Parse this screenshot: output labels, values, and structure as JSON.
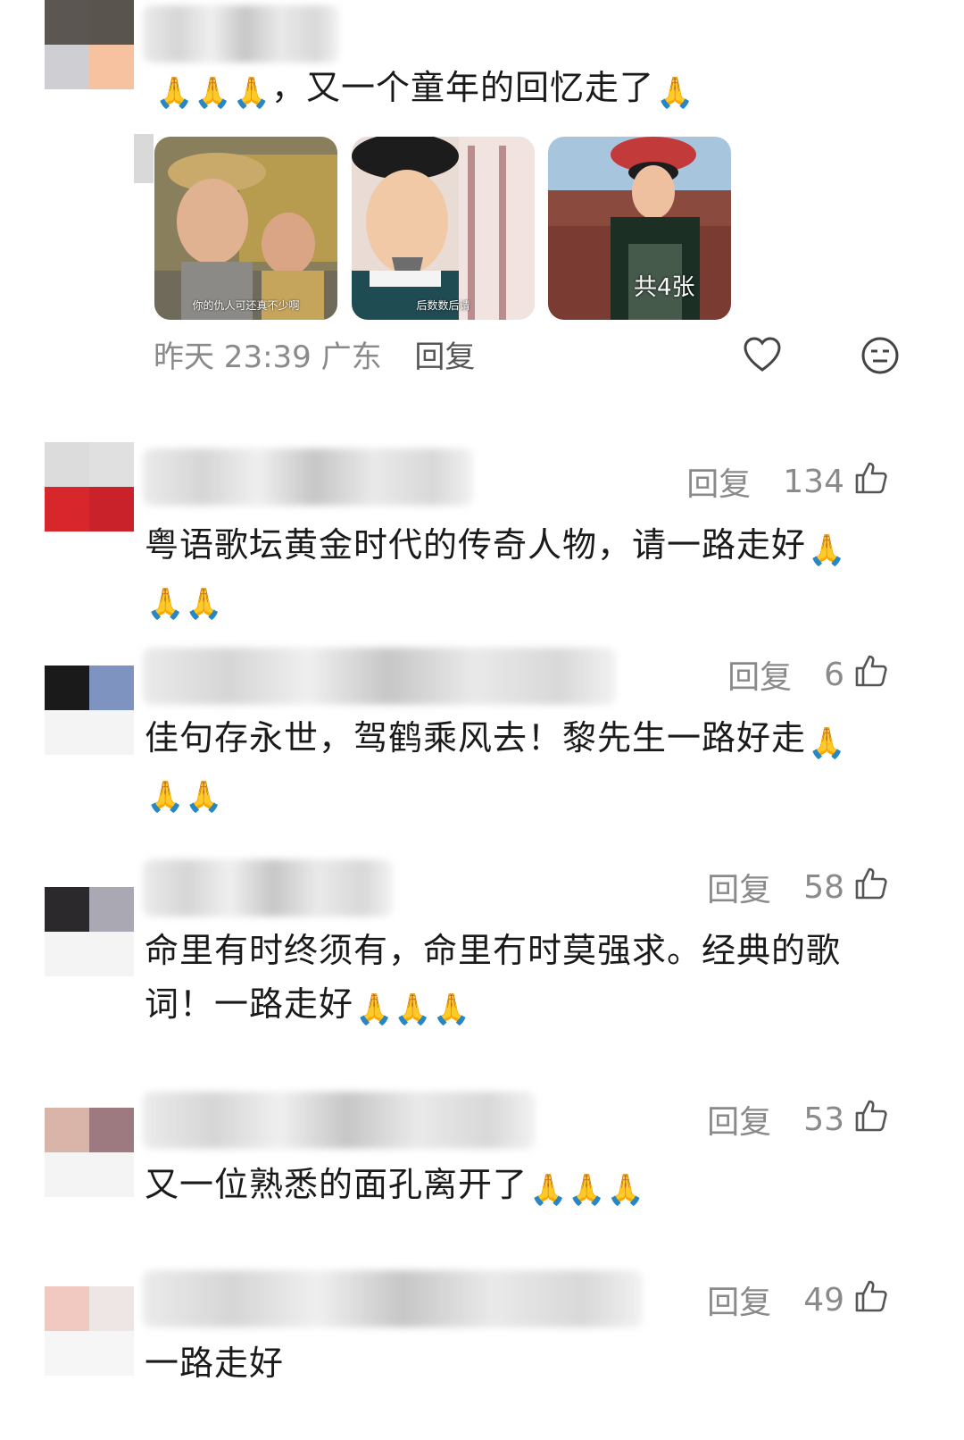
{
  "top_comment": {
    "text": "，又一个童年的回忆走了",
    "lead_emoji": "🙏🙏🙏",
    "trail_emoji": "🙏",
    "time": "昨天 23:39",
    "location": "广东",
    "reply_label": "回复",
    "photos": [
      {
        "caption": "你的仇人可还真不少啊"
      },
      {
        "caption": "后数数后请"
      },
      {
        "caption": "",
        "count_label": "共4张"
      }
    ]
  },
  "comments": [
    {
      "reply_label": "回复",
      "likes": "134",
      "text": "粤语歌坛黄金时代的传奇人物，请一路走好",
      "emoji_after": "🙏",
      "emoji_line2": "🙏🙏"
    },
    {
      "reply_label": "回复",
      "likes": "6",
      "text": "佳句存永世，驾鹤乘风去！黎先生一路好走",
      "emoji_after": "🙏",
      "emoji_line2": "🙏🙏"
    },
    {
      "reply_label": "回复",
      "likes": "58",
      "text": "命里有时终须有，命里冇时莫强求。经典的歌",
      "line2": "词！一路走好",
      "emoji_line2": "🙏🙏🙏"
    },
    {
      "reply_label": "回复",
      "likes": "53",
      "text": "又一位熟悉的面孔离开了",
      "emoji_after": "🙏🙏🙏"
    },
    {
      "reply_label": "回复",
      "likes": "49",
      "text": "一路走好"
    }
  ],
  "colors": {
    "meta_gray": "#8a8a8a",
    "text": "#1a1a1a"
  },
  "icons": [
    "heart-icon",
    "neutral-face-icon",
    "thumbs-up-icon",
    "pray-emoji"
  ]
}
